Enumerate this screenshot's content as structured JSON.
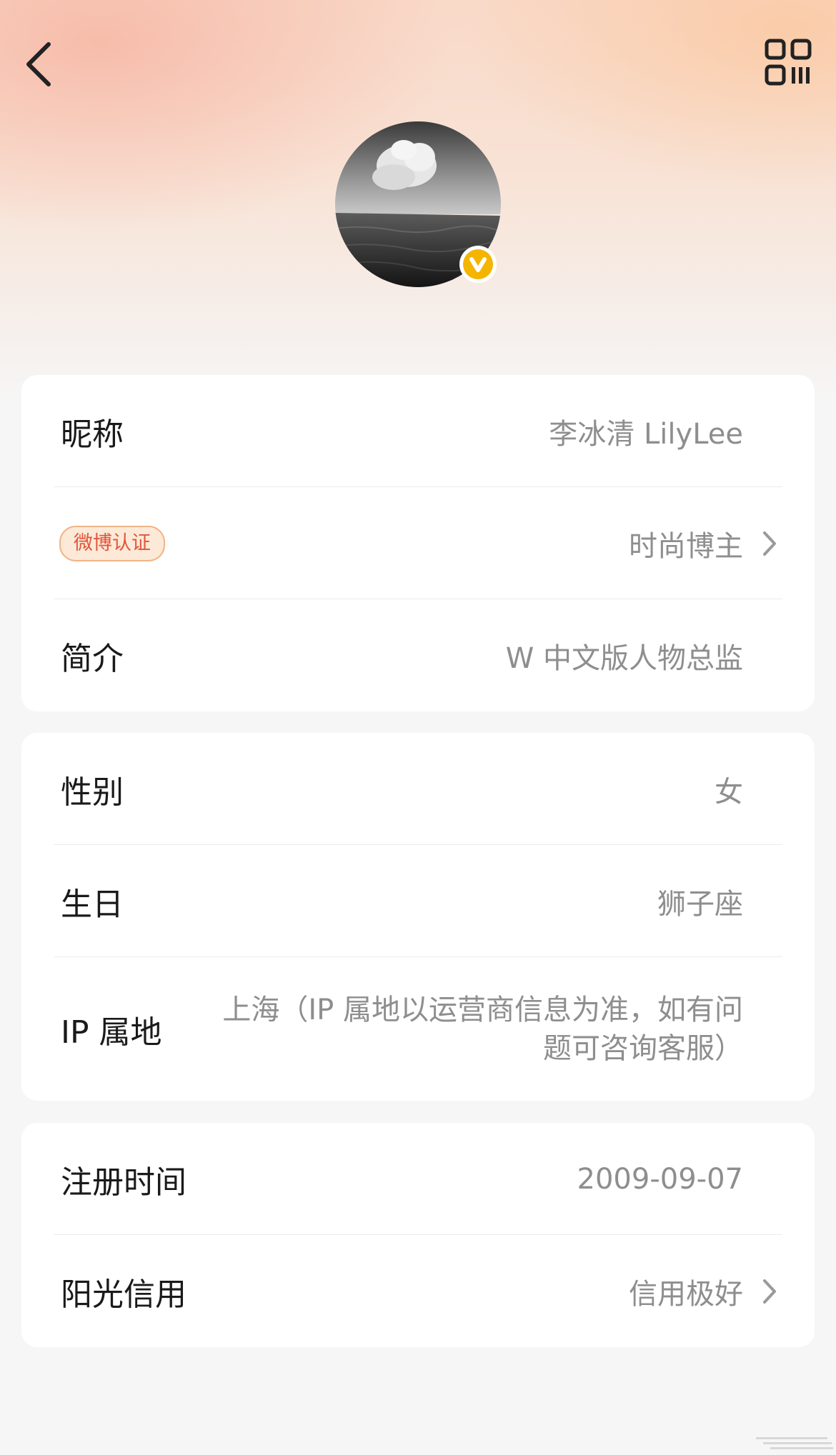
{
  "header": {
    "back_icon": "chevron-left-icon",
    "qr_icon": "qr-code-icon"
  },
  "profile": {
    "avatar": "avatar-image",
    "badge_letter": "V",
    "badge_color": "#f4b400"
  },
  "card1": {
    "nickname_label": "昵称",
    "nickname_value": "李冰清 LilyLee",
    "verify_tag": "微博认证",
    "verify_value": "时尚博主",
    "intro_label": "简介",
    "intro_value": "W 中文版人物总监"
  },
  "card2": {
    "gender_label": "性别",
    "gender_value": "女",
    "birthday_label": "生日",
    "birthday_value": "狮子座",
    "ip_label": "IP 属地",
    "ip_value": "上海（IP 属地以运营商信息为准，如有问题可咨询客服）"
  },
  "card3": {
    "register_label": "注册时间",
    "register_value": "2009-09-07",
    "credit_label": "阳光信用",
    "credit_value": "信用极好"
  },
  "colors": {
    "tag_text": "#e2553a",
    "tag_bg": "#fde9d7",
    "value_text": "#8e8e8e"
  }
}
